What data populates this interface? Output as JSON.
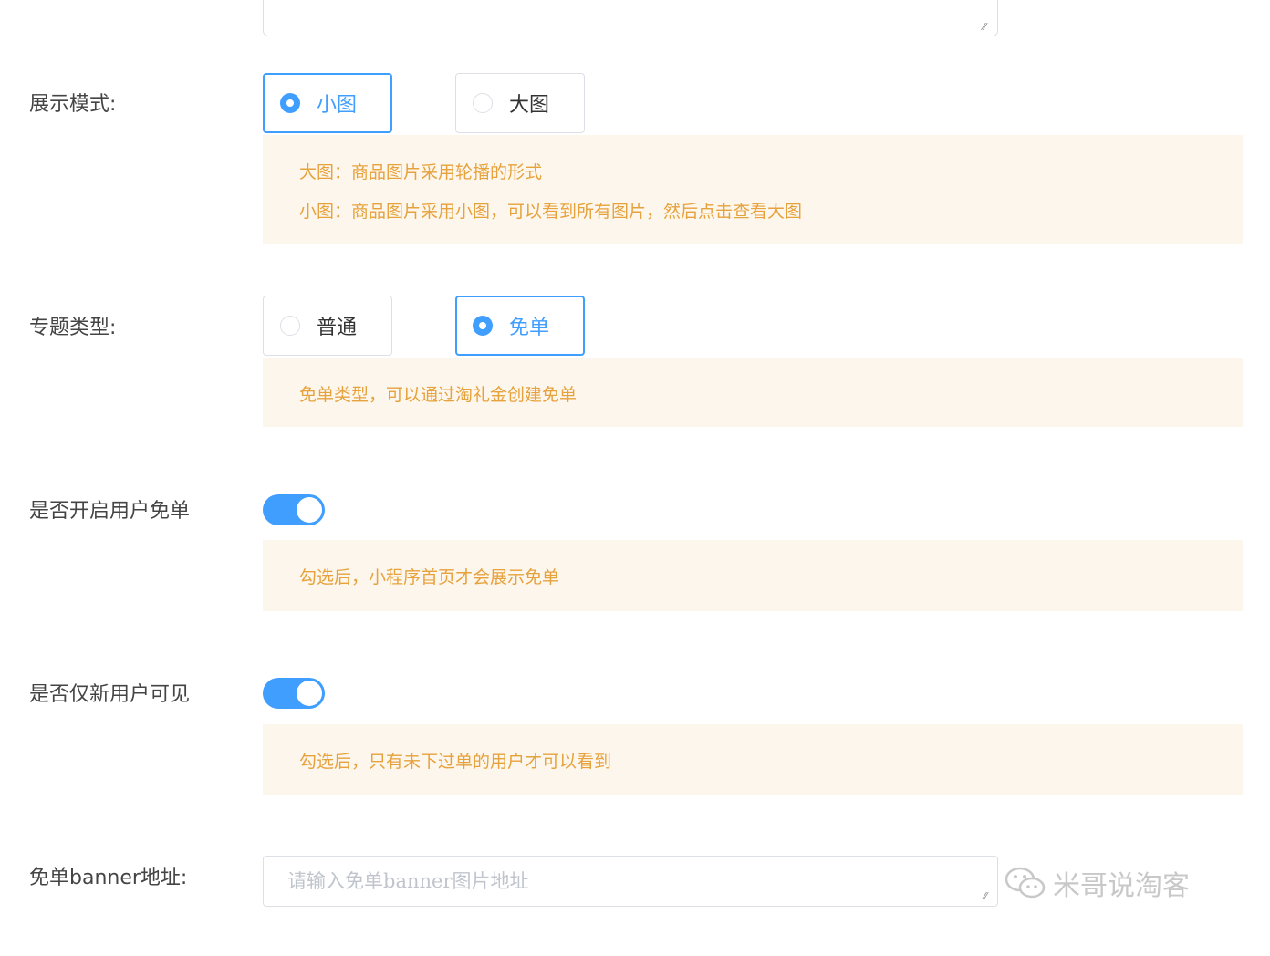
{
  "display_mode": {
    "label": "展示模式:",
    "options": [
      {
        "label": "小图",
        "checked": true
      },
      {
        "label": "大图",
        "checked": false
      }
    ],
    "tips": [
      "大图：商品图片采用轮播的形式",
      "小图：商品图片采用小图，可以看到所有图片，然后点击查看大图"
    ]
  },
  "topic_type": {
    "label": "专题类型:",
    "options": [
      {
        "label": "普通",
        "checked": false
      },
      {
        "label": "免单",
        "checked": true
      }
    ],
    "tips": [
      "免单类型，可以通过淘礼金创建免单"
    ]
  },
  "enable_free_order": {
    "label": "是否开启用户免单",
    "on": true,
    "tip": "勾选后，小程序首页才会展示免单"
  },
  "new_user_only": {
    "label": "是否仅新用户可见",
    "on": true,
    "tip": "勾选后，只有未下过单的用户才可以看到"
  },
  "banner": {
    "label": "免单banner地址:",
    "placeholder": "请输入免单banner图片地址",
    "value": ""
  },
  "watermark": {
    "text": "米哥说淘客",
    "icon": "wechat-icon"
  },
  "colors": {
    "primary": "#409eff",
    "warning_bg": "#fdf6ec",
    "warning_text": "#e6a23c"
  }
}
